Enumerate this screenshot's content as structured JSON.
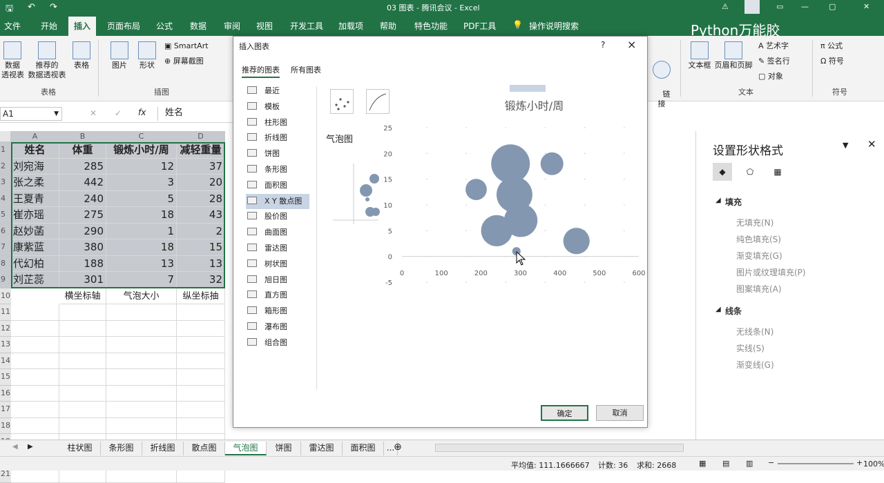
{
  "title_bar": {
    "title": "03 图表 - 腾讯会议 - Excel"
  },
  "ribbon_tabs": [
    "文件",
    "开始",
    "插入",
    "页面布局",
    "公式",
    "数据",
    "审阅",
    "视图",
    "开发工具",
    "加载项",
    "帮助",
    "特色功能",
    "PDF工具",
    "操作说明搜索"
  ],
  "active_tab": "插入",
  "watermark": "Python万能胶",
  "ribbon": {
    "pivot": "数据\n透视表",
    "rec_pivot": "推荐的\n数据透视表",
    "table": "表格",
    "group_tables": "表格",
    "picture": "图片",
    "shapes": "形状",
    "smartart": "SmartArt",
    "screenshot": "屏幕截图",
    "group_illustrations": "插图",
    "link": "链\n接",
    "textbox": "文本框",
    "header_footer": "页眉和页脚",
    "wordart": "艺术字",
    "signature": "签名行",
    "object": "对象",
    "group_text": "文本",
    "equation": "公式",
    "symbol": "符号",
    "group_symbols": "符号"
  },
  "name_box": "A1",
  "formula": "姓名",
  "columns": [
    "A",
    "B",
    "C",
    "D"
  ],
  "rows": [
    "1",
    "2",
    "3",
    "4",
    "5",
    "6",
    "7",
    "8",
    "9",
    "10",
    "11",
    "12",
    "13",
    "14",
    "15",
    "16",
    "17",
    "18",
    "19",
    "20",
    "21"
  ],
  "table": {
    "headers": [
      "姓名",
      "体重",
      "锻炼小时/周",
      "减轻重量"
    ],
    "data": [
      [
        "刘宛海",
        "285",
        "12",
        "37"
      ],
      [
        "张之柔",
        "442",
        "3",
        "20"
      ],
      [
        "王夏青",
        "240",
        "5",
        "28"
      ],
      [
        "崔亦瑶",
        "275",
        "18",
        "43"
      ],
      [
        "赵妙菡",
        "290",
        "1",
        "2"
      ],
      [
        "康紫蓝",
        "380",
        "18",
        "15"
      ],
      [
        "代幻柏",
        "188",
        "13",
        "13"
      ],
      [
        "刘芷蕊",
        "301",
        "7",
        "32"
      ]
    ],
    "notes": [
      "横坐标轴",
      "气泡大小",
      "纵坐标抽"
    ]
  },
  "sheet_tabs": [
    "柱状图",
    "条形图",
    "折线图",
    "散点图",
    "气泡图",
    "饼图",
    "雷达图",
    "面积图",
    "..."
  ],
  "active_sheet": "气泡图",
  "status": {
    "avg": "平均值: 111.1666667",
    "count": "计数: 36",
    "sum": "求和: 2668",
    "zoom": "100%"
  },
  "dialog": {
    "title": "插入图表",
    "help": "?",
    "close": "×",
    "tab_recommended": "推荐的图表",
    "tab_all": "所有图表",
    "nav": [
      "最近",
      "模板",
      "柱形图",
      "折线图",
      "饼图",
      "条形图",
      "面积图",
      "X Y 散点图",
      "股价图",
      "曲面图",
      "雷达图",
      "树状图",
      "旭日图",
      "直方图",
      "箱形图",
      "瀑布图",
      "组合图"
    ],
    "active_nav": "X Y 散点图",
    "chart_kind": "气泡图",
    "ok": "确定",
    "cancel": "取消"
  },
  "chart_data": {
    "type": "scatter",
    "subtype": "bubble",
    "title": "锻炼小时/周",
    "xlim": [
      0,
      600
    ],
    "ylim": [
      -5,
      25
    ],
    "xticks": [
      "0",
      "100",
      "200",
      "300",
      "400",
      "500",
      "600"
    ],
    "yticks": [
      "25",
      "20",
      "15",
      "10",
      "5",
      "0",
      "-5"
    ],
    "points": [
      {
        "x": 285,
        "y": 12,
        "size": 37
      },
      {
        "x": 442,
        "y": 3,
        "size": 20
      },
      {
        "x": 240,
        "y": 5,
        "size": 28
      },
      {
        "x": 275,
        "y": 18,
        "size": 43
      },
      {
        "x": 290,
        "y": 1,
        "size": 2
      },
      {
        "x": 380,
        "y": 18,
        "size": 15
      },
      {
        "x": 188,
        "y": 13,
        "size": 13
      },
      {
        "x": 301,
        "y": 7,
        "size": 32
      }
    ],
    "bubble_color": "#8497b0"
  },
  "format_pane": {
    "title": "设置形状格式",
    "fill_header": "填充",
    "fill_options": [
      "无填充(N)",
      "纯色填充(S)",
      "渐变填充(G)",
      "图片或纹理填充(P)",
      "图案填充(A)"
    ],
    "line_header": "线条",
    "line_options": [
      "无线条(N)",
      "实线(S)",
      "渐变线(G)"
    ]
  },
  "colors": {
    "excel_green": "#217346",
    "selection": "#c6c9ce"
  }
}
